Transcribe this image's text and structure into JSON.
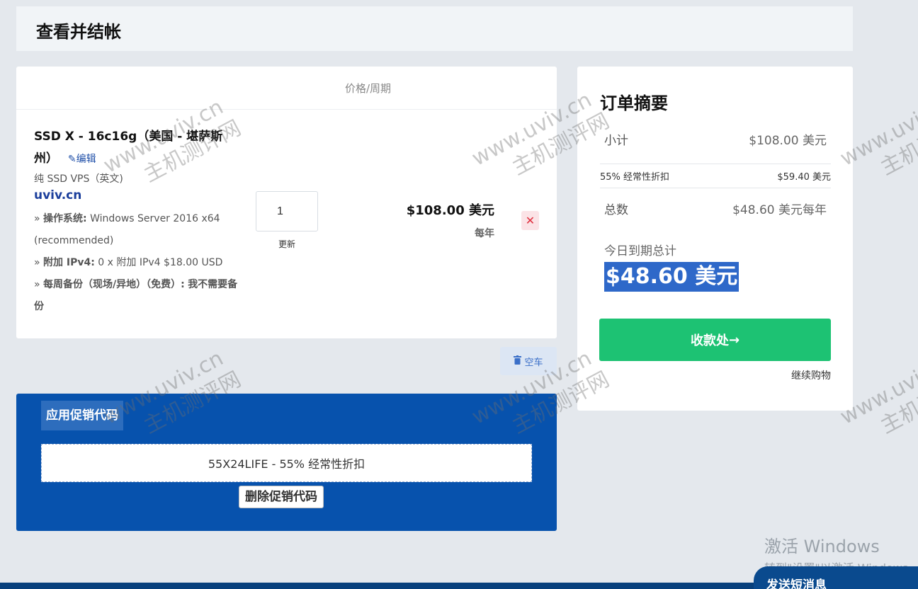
{
  "page": {
    "title": "查看并结帐"
  },
  "cart": {
    "column_header": "价格/周期",
    "item": {
      "name": "SSD X - 16c16g（美国 - 堪萨斯州）",
      "edit_label": "编辑",
      "group": "纯 SSD VPS（英文)",
      "domain": "uviv.cn",
      "options": [
        {
          "key": "操作系统:",
          "value": "Windows Server 2016 x64 (recommended)"
        },
        {
          "key": "附加 IPv4:",
          "value": "0 x 附加 IPv4 $18.00 USD"
        },
        {
          "key": "每周备份（现场/异地）（免费）:",
          "value": "我不需要备份"
        }
      ],
      "quantity": "1",
      "update_label": "更新",
      "price": "$108.00 美元",
      "cycle": "每年",
      "remove_symbol": "✕"
    },
    "empty_label": "空车"
  },
  "promo": {
    "title": "应用促销代码",
    "applied_code": "55X24LIFE - 55% 经常性折扣",
    "remove_label": "删除促销代码"
  },
  "summary": {
    "title": "订单摘要",
    "subtotal_label": "小计",
    "subtotal_value": "$108.00 美元",
    "discount_label": "55% 经常性折扣",
    "discount_value": "$59.40 美元",
    "total_label": "总数",
    "total_value": "$48.60 美元每年",
    "due_today_label": "今日到期总计",
    "due_today_value": "$48.60 美元",
    "checkout_label": "收款处",
    "continue_label": "继续购物"
  },
  "windows_activation": {
    "title": "激活 Windows",
    "subtitle": "转到\"设置\"以激活 Windows。"
  },
  "chat": {
    "tab_label": "发送短消息"
  },
  "watermark": {
    "site": "www.uviv.cn",
    "name": "主机测评网"
  },
  "icons": {
    "edit": "pencil-icon",
    "trash": "trash-icon",
    "arrow": "arrow-right-icon",
    "remove": "close-icon"
  },
  "colors": {
    "promo_bg": "#0752ad",
    "checkout_bg": "#1dc273",
    "remove_bg": "#fbe3e6",
    "link": "#1c3f9c",
    "highlight": "#2e68c9"
  }
}
